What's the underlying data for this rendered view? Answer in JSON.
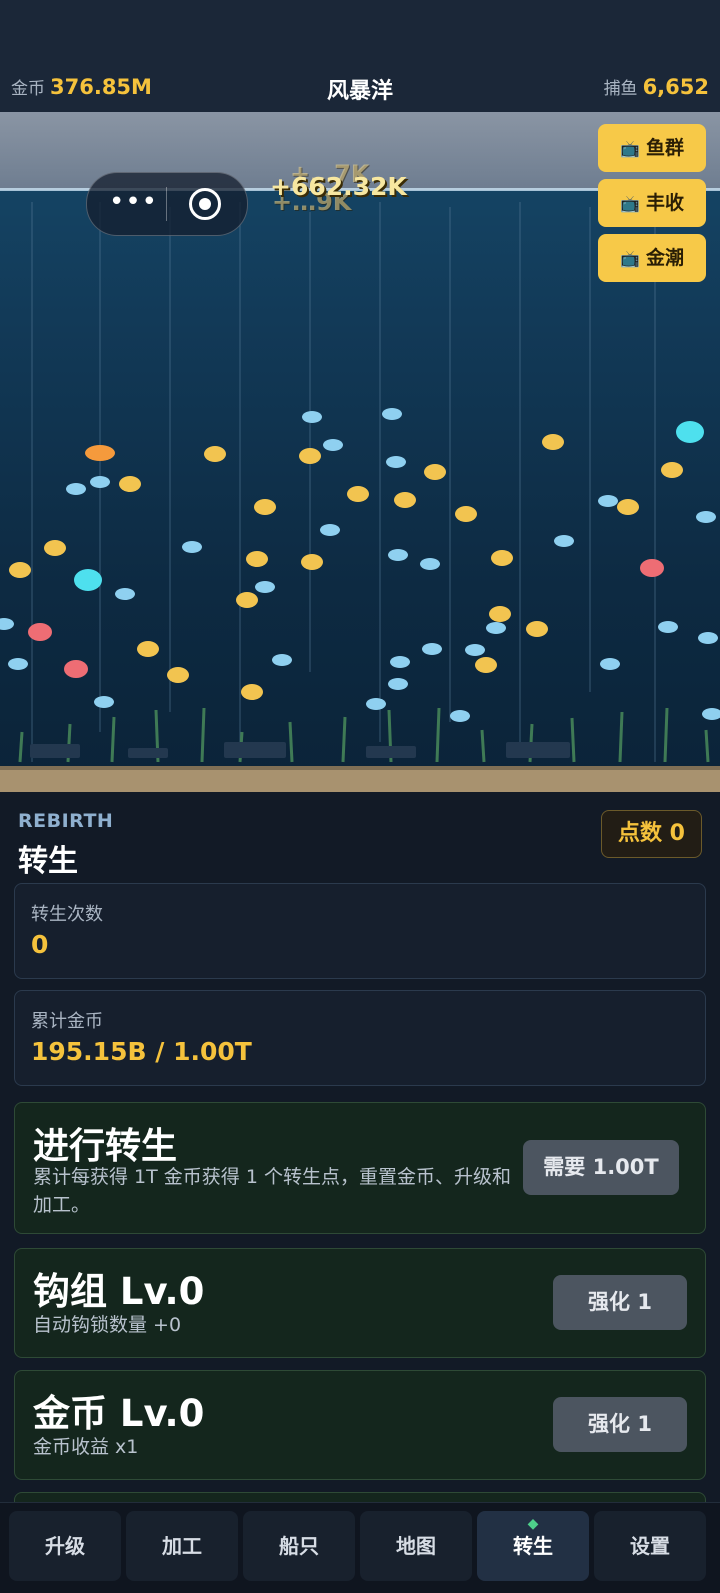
{
  "hud": {
    "coins_label": "金币",
    "coins_value": "376.85M",
    "title": "风暴洋",
    "catch_label": "捕鱼",
    "catch_value": "6,652"
  },
  "boosts": [
    {
      "icon": "tv-icon",
      "label": "鱼群"
    },
    {
      "icon": "tv-icon",
      "label": "丰收"
    },
    {
      "icon": "tv-icon",
      "label": "金潮"
    }
  ],
  "floating_gain": "+662.32K",
  "ghost_gains": [
    "+…7K",
    "+…9K"
  ],
  "rebirth": {
    "title_en": "REBIRTH",
    "title_cn": "转生",
    "points_label": "点数 0",
    "count_label": "转生次数",
    "count_value": "0",
    "total_label": "累计金币",
    "total_value": "195.15B / 1.00T",
    "action": {
      "title": "进行转生",
      "desc": "累计每获得 1T 金币获得 1 个转生点，重置金币、升级和加工。",
      "button": "需要 1.00T"
    },
    "upgrades": [
      {
        "title": "钩组 Lv.0",
        "desc": "自动钩锁数量 +0",
        "button": "强化 1"
      },
      {
        "title": "金币 Lv.0",
        "desc": "金币收益 x1",
        "button": "强化 1"
      }
    ]
  },
  "tabs": [
    "升级",
    "加工",
    "船只",
    "地图",
    "转生",
    "设置"
  ],
  "active_tab": "转生",
  "colors": {
    "accent_gold": "#f5c23c",
    "boost_yellow": "#f7c948",
    "active_gem": "#4ed08a"
  }
}
